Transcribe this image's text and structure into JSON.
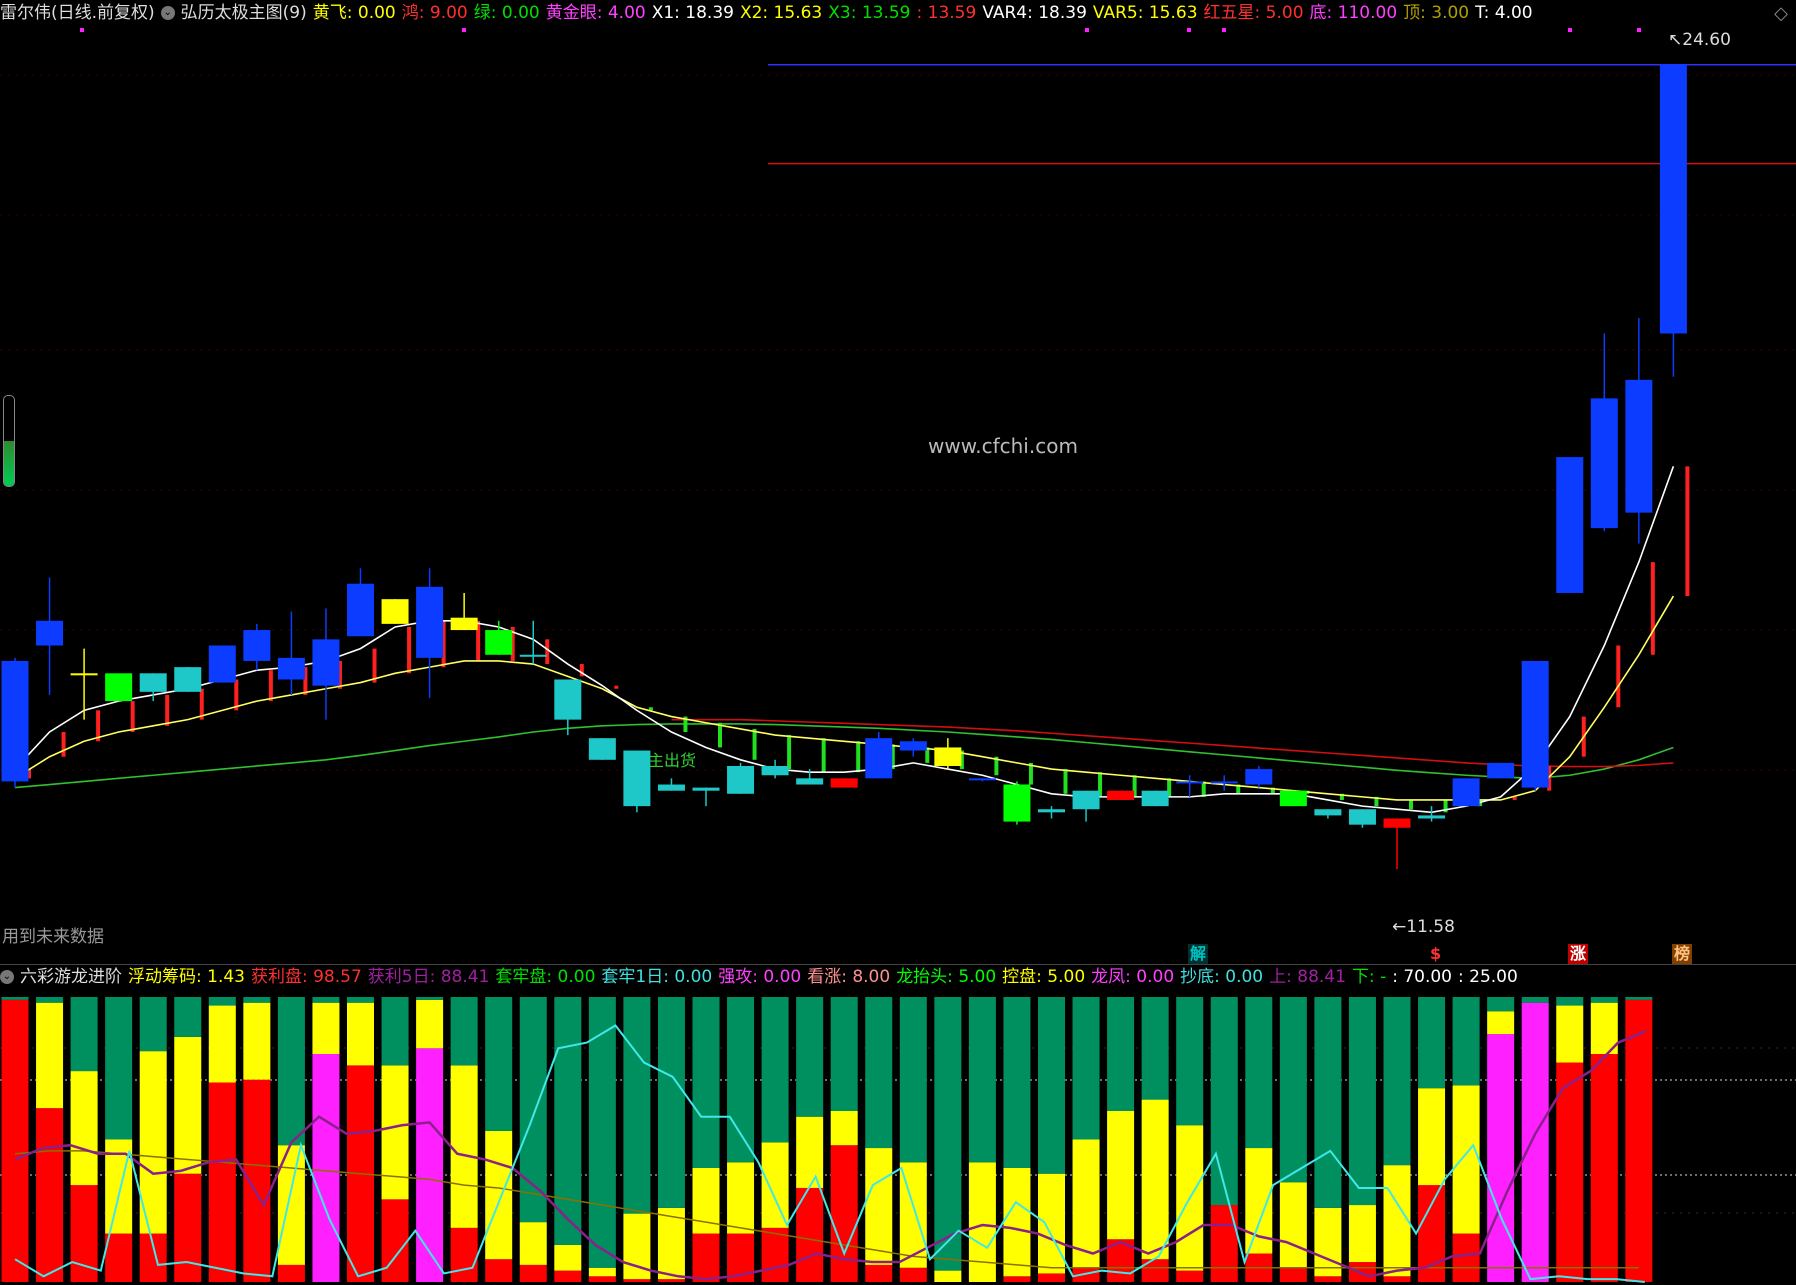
{
  "main_panel": {
    "title": "雷尔伟(日线.前复权)",
    "indicator_name": "弘历太极主图(9)",
    "indicators": [
      {
        "label": "黄飞:",
        "value": "0.00",
        "color": "#ffff00"
      },
      {
        "label": "鸿:",
        "value": "9.00",
        "color": "#ff3030"
      },
      {
        "label": "绿:",
        "value": "0.00",
        "color": "#00e000"
      },
      {
        "label": "黄金眼:",
        "value": "4.00",
        "color": "#ff40ff"
      },
      {
        "label": "X1:",
        "value": "18.39",
        "color": "#ffffff"
      },
      {
        "label": "X2:",
        "value": "15.63",
        "color": "#ffff00"
      },
      {
        "label": "X3:",
        "value": "13.59",
        "color": "#00e000"
      },
      {
        "label": ":",
        "value": "13.59",
        "color": "#ff3030"
      },
      {
        "label": "VAR4:",
        "value": "18.39",
        "color": "#ffffff"
      },
      {
        "label": "VAR5:",
        "value": "15.63",
        "color": "#ffff00"
      },
      {
        "label": "红五星:",
        "value": "5.00",
        "color": "#ff3030"
      },
      {
        "label": "底:",
        "value": "110.00",
        "color": "#ff40ff"
      },
      {
        "label": "顶:",
        "value": "3.00",
        "color": "#b0a000"
      },
      {
        "label": "T:",
        "value": "4.00",
        "color": "#ffffff"
      }
    ],
    "watermark": "www.cfchi.com",
    "future_data_note": "用到未来数据",
    "high_marker": "24.60",
    "low_marker": "11.58",
    "overlay_text": "主出货",
    "signal_badges": [
      {
        "text": "解",
        "color": "#00c0c0",
        "bg": "#003030"
      },
      {
        "text": "$",
        "color": "#ff3030",
        "bg": "transparent"
      },
      {
        "text": "涨",
        "color": "#ffffff",
        "bg": "#c00000"
      },
      {
        "text": "榜",
        "color": "#ffc080",
        "bg": "#804000"
      }
    ]
  },
  "sub_panel": {
    "indicator_name": "六彩游龙进阶",
    "indicators": [
      {
        "label": "浮动筹码:",
        "value": "1.43",
        "color": "#ffff00"
      },
      {
        "label": "获利盘:",
        "value": "98.57",
        "color": "#ff3030"
      },
      {
        "label": "获利5日:",
        "value": "88.41",
        "color": "#a020a0"
      },
      {
        "label": "套牢盘:",
        "value": "0.00",
        "color": "#00e000"
      },
      {
        "label": "套牢1日:",
        "value": "0.00",
        "color": "#40e0e0"
      },
      {
        "label": "强攻:",
        "value": "0.00",
        "color": "#ff40ff"
      },
      {
        "label": "看涨:",
        "value": "8.00",
        "color": "#ff9090"
      },
      {
        "label": "龙抬头:",
        "value": "5.00",
        "color": "#00ff00"
      },
      {
        "label": "控盘:",
        "value": "5.00",
        "color": "#ffff00"
      },
      {
        "label": "龙凤:",
        "value": "0.00",
        "color": "#ff40ff"
      },
      {
        "label": "抄底:",
        "value": "0.00",
        "color": "#40e0e0"
      },
      {
        "label": "上:",
        "value": "88.41",
        "color": "#a020a0"
      },
      {
        "label": "下:",
        "value": "-",
        "color": "#00e000"
      },
      {
        "label": ":",
        "value": "70.00",
        "color": "#ffffff"
      },
      {
        "label": ":",
        "value": "25.00",
        "color": "#ffffff"
      }
    ]
  },
  "colors": {
    "up_blue": "#0b3cff",
    "down_cyan": "#1ec8c8",
    "yellow": "#ffff00",
    "green": "#00ff00",
    "red": "#ff0000",
    "magenta": "#ff20ff",
    "dark_green": "#009060",
    "ma_white": "#ffffff",
    "ma_yellow": "#ffff60",
    "ma_green": "#30c030",
    "ma_red": "#d01010"
  },
  "chart_data": {
    "type": "candlestick",
    "price_range": [
      11.0,
      25.0
    ],
    "candles": [
      {
        "o": 13.0,
        "h": 15.0,
        "l": 12.9,
        "c": 14.95,
        "color": "blue"
      },
      {
        "o": 15.2,
        "h": 16.3,
        "l": 14.4,
        "c": 15.6,
        "color": "blue"
      },
      {
        "o": 14.75,
        "h": 15.15,
        "l": 14.0,
        "c": 14.75,
        "color": "yellow"
      },
      {
        "o": 14.3,
        "h": 14.7,
        "l": 14.3,
        "c": 14.75,
        "color": "green"
      },
      {
        "o": 14.45,
        "h": 14.75,
        "l": 14.3,
        "c": 14.75,
        "color": "cyan"
      },
      {
        "o": 14.45,
        "h": 14.85,
        "l": 14.45,
        "c": 14.85,
        "color": "cyan"
      },
      {
        "o": 14.6,
        "h": 15.2,
        "l": 14.6,
        "c": 15.2,
        "color": "blue"
      },
      {
        "o": 14.95,
        "h": 15.55,
        "l": 14.8,
        "c": 15.45,
        "color": "blue"
      },
      {
        "o": 14.65,
        "h": 15.75,
        "l": 14.4,
        "c": 15.0,
        "color": "blue"
      },
      {
        "o": 14.55,
        "h": 15.8,
        "l": 14.0,
        "c": 15.3,
        "color": "blue"
      },
      {
        "o": 15.35,
        "h": 16.45,
        "l": 15.35,
        "c": 16.2,
        "color": "blue"
      },
      {
        "o": 15.55,
        "h": 15.95,
        "l": 15.55,
        "c": 15.95,
        "color": "yellow"
      },
      {
        "o": 15.0,
        "h": 16.45,
        "l": 14.35,
        "c": 16.15,
        "color": "blue"
      },
      {
        "o": 15.65,
        "h": 16.05,
        "l": 15.45,
        "c": 15.45,
        "color": "yellow"
      },
      {
        "o": 15.45,
        "h": 15.6,
        "l": 15.05,
        "c": 15.05,
        "color": "green"
      },
      {
        "o": 15.05,
        "h": 15.6,
        "l": 14.9,
        "c": 15.05,
        "color": "cyan"
      },
      {
        "o": 14.65,
        "h": 14.65,
        "l": 13.75,
        "c": 14.0,
        "color": "cyan"
      },
      {
        "o": 13.7,
        "h": 13.7,
        "l": 13.35,
        "c": 13.35,
        "color": "cyan"
      },
      {
        "o": 13.5,
        "h": 13.5,
        "l": 12.5,
        "c": 12.6,
        "color": "cyan"
      },
      {
        "o": 12.95,
        "h": 13.05,
        "l": 12.85,
        "c": 12.85,
        "color": "cyan"
      },
      {
        "o": 12.9,
        "h": 12.9,
        "l": 12.6,
        "c": 12.85,
        "color": "cyan"
      },
      {
        "o": 13.25,
        "h": 13.3,
        "l": 12.8,
        "c": 12.8,
        "color": "cyan"
      },
      {
        "o": 13.25,
        "h": 13.35,
        "l": 13.05,
        "c": 13.1,
        "color": "cyan"
      },
      {
        "o": 13.05,
        "h": 13.2,
        "l": 12.95,
        "c": 12.95,
        "color": "cyan"
      },
      {
        "o": 13.05,
        "h": 13.05,
        "l": 12.9,
        "c": 12.9,
        "color": "red"
      },
      {
        "o": 13.05,
        "h": 13.8,
        "l": 13.05,
        "c": 13.7,
        "color": "blue"
      },
      {
        "o": 13.5,
        "h": 13.7,
        "l": 13.4,
        "c": 13.65,
        "color": "blue"
      },
      {
        "o": 13.25,
        "h": 13.7,
        "l": 13.2,
        "c": 13.55,
        "color": "yellow"
      },
      {
        "o": 13.05,
        "h": 13.05,
        "l": 13.0,
        "c": 13.05,
        "color": "blue"
      },
      {
        "o": 12.35,
        "h": 13.0,
        "l": 12.3,
        "c": 12.95,
        "color": "green"
      },
      {
        "o": 12.5,
        "h": 12.6,
        "l": 12.4,
        "c": 12.55,
        "color": "cyan"
      },
      {
        "o": 12.85,
        "h": 12.85,
        "l": 12.35,
        "c": 12.55,
        "color": "cyan"
      },
      {
        "o": 12.7,
        "h": 12.85,
        "l": 12.7,
        "c": 12.85,
        "color": "red"
      },
      {
        "o": 12.85,
        "h": 12.85,
        "l": 12.6,
        "c": 12.6,
        "color": "cyan"
      },
      {
        "o": 13.0,
        "h": 13.1,
        "l": 12.75,
        "c": 13.0,
        "color": "blue"
      },
      {
        "o": 13.0,
        "h": 13.1,
        "l": 12.85,
        "c": 13.0,
        "color": "blue"
      },
      {
        "o": 13.2,
        "h": 13.25,
        "l": 12.9,
        "c": 12.95,
        "color": "blue"
      },
      {
        "o": 12.85,
        "h": 12.85,
        "l": 12.6,
        "c": 12.6,
        "color": "green"
      },
      {
        "o": 12.55,
        "h": 12.55,
        "l": 12.4,
        "c": 12.45,
        "color": "cyan"
      },
      {
        "o": 12.55,
        "h": 12.55,
        "l": 12.25,
        "c": 12.3,
        "color": "cyan"
      },
      {
        "o": 12.4,
        "h": 12.4,
        "l": 11.58,
        "c": 12.25,
        "color": "red"
      },
      {
        "o": 12.4,
        "h": 12.6,
        "l": 12.35,
        "c": 12.45,
        "color": "cyan"
      },
      {
        "o": 12.6,
        "h": 13.05,
        "l": 12.6,
        "c": 13.05,
        "color": "blue"
      },
      {
        "o": 13.05,
        "h": 13.3,
        "l": 13.05,
        "c": 13.3,
        "color": "blue"
      },
      {
        "o": 12.9,
        "h": 14.95,
        "l": 12.85,
        "c": 14.95,
        "color": "blue"
      },
      {
        "o": 16.05,
        "h": 18.25,
        "l": 16.05,
        "c": 18.25,
        "color": "blue"
      },
      {
        "o": 17.1,
        "h": 20.25,
        "l": 17.05,
        "c": 19.2,
        "color": "blue"
      },
      {
        "o": 17.35,
        "h": 20.5,
        "l": 16.85,
        "c": 19.5,
        "color": "blue"
      },
      {
        "o": 20.25,
        "h": 24.6,
        "l": 19.55,
        "c": 24.6,
        "color": "blue"
      }
    ],
    "ma_white": [
      13.2,
      13.8,
      14.15,
      14.3,
      14.4,
      14.5,
      14.65,
      14.8,
      14.85,
      14.95,
      15.15,
      15.5,
      15.6,
      15.6,
      15.5,
      15.3,
      14.9,
      14.55,
      14.15,
      13.8,
      13.55,
      13.35,
      13.2,
      13.15,
      13.15,
      13.2,
      13.3,
      13.2,
      13.1,
      12.95,
      12.8,
      12.75,
      12.75,
      12.75,
      12.75,
      12.8,
      12.8,
      12.8,
      12.7,
      12.6,
      12.55,
      12.5,
      12.6,
      12.75,
      13.25,
      14.05,
      15.2,
      16.55,
      18.1
    ],
    "ma_yellow": [
      13.05,
      13.4,
      13.65,
      13.8,
      13.9,
      14.0,
      14.15,
      14.3,
      14.4,
      14.5,
      14.6,
      14.75,
      14.85,
      14.95,
      14.95,
      14.9,
      14.7,
      14.5,
      14.2,
      14.05,
      13.95,
      13.85,
      13.75,
      13.7,
      13.65,
      13.6,
      13.55,
      13.5,
      13.4,
      13.3,
      13.2,
      13.15,
      13.1,
      13.05,
      13.0,
      12.95,
      12.9,
      12.85,
      12.8,
      12.75,
      12.7,
      12.7,
      12.7,
      12.7,
      12.85,
      13.4,
      14.2,
      15.05,
      16.0
    ],
    "ma_green": [
      12.9,
      12.95,
      13.0,
      13.05,
      13.1,
      13.15,
      13.2,
      13.25,
      13.3,
      13.35,
      13.42,
      13.5,
      13.58,
      13.65,
      13.72,
      13.8,
      13.86,
      13.9,
      13.92,
      13.93,
      13.93,
      13.93,
      13.92,
      13.9,
      13.88,
      13.86,
      13.83,
      13.8,
      13.76,
      13.72,
      13.68,
      13.63,
      13.58,
      13.53,
      13.48,
      13.43,
      13.38,
      13.33,
      13.28,
      13.23,
      13.18,
      13.14,
      13.1,
      13.07,
      13.05,
      13.1,
      13.2,
      13.35,
      13.55
    ],
    "ma_red_from_index": 19,
    "ma_red": [
      14.0,
      14.0,
      14.0,
      13.98,
      13.96,
      13.94,
      13.92,
      13.9,
      13.88,
      13.85,
      13.82,
      13.78,
      13.74,
      13.7,
      13.66,
      13.62,
      13.58,
      13.54,
      13.5,
      13.46,
      13.42,
      13.38,
      13.34,
      13.3,
      13.27,
      13.25,
      13.24,
      13.24,
      13.26,
      13.3
    ],
    "horizontal_lines": [
      {
        "price": 24.6,
        "color": "#3030ff"
      },
      {
        "price": 23.0,
        "color": "#d01010"
      }
    ],
    "sub_bars": [
      {
        "m": 0,
        "r": 99,
        "y": 0,
        "g": 1
      },
      {
        "m": 0,
        "r": 61,
        "y": 37,
        "g": 2
      },
      {
        "m": 0,
        "r": 34,
        "y": 40,
        "g": 26
      },
      {
        "m": 0,
        "r": 17,
        "y": 33,
        "g": 50
      },
      {
        "m": 0,
        "r": 17,
        "y": 64,
        "g": 19
      },
      {
        "m": 0,
        "r": 38,
        "y": 48,
        "g": 14
      },
      {
        "m": 0,
        "r": 70,
        "y": 27,
        "g": 3
      },
      {
        "m": 0,
        "r": 71,
        "y": 27,
        "g": 2
      },
      {
        "m": 0,
        "r": 6,
        "y": 42,
        "g": 52
      },
      {
        "m": 80,
        "r": 0,
        "y": 18,
        "g": 2
      },
      {
        "m": 0,
        "r": 76,
        "y": 22,
        "g": 2
      },
      {
        "m": 0,
        "r": 29,
        "y": 47,
        "g": 24
      },
      {
        "m": 82,
        "r": 0,
        "y": 17,
        "g": 1
      },
      {
        "m": 0,
        "r": 19,
        "y": 57,
        "g": 24
      },
      {
        "m": 0,
        "r": 8,
        "y": 45,
        "g": 47
      },
      {
        "m": 0,
        "r": 6,
        "y": 15,
        "g": 79
      },
      {
        "m": 0,
        "r": 4,
        "y": 9,
        "g": 87
      },
      {
        "m": 0,
        "r": 2,
        "y": 3,
        "g": 95
      },
      {
        "m": 0,
        "r": 1,
        "y": 23,
        "g": 76
      },
      {
        "m": 0,
        "r": 1,
        "y": 25,
        "g": 74
      },
      {
        "m": 0,
        "r": 17,
        "y": 23,
        "g": 60
      },
      {
        "m": 0,
        "r": 17,
        "y": 25,
        "g": 58
      },
      {
        "m": 0,
        "r": 19,
        "y": 30,
        "g": 51
      },
      {
        "m": 0,
        "r": 33,
        "y": 25,
        "g": 42
      },
      {
        "m": 0,
        "r": 48,
        "y": 12,
        "g": 40
      },
      {
        "m": 0,
        "r": 6,
        "y": 41,
        "g": 53
      },
      {
        "m": 0,
        "r": 5,
        "y": 37,
        "g": 58
      },
      {
        "m": 0,
        "r": 0,
        "y": 4,
        "g": 96
      },
      {
        "m": 0,
        "r": 0,
        "y": 42,
        "g": 58
      },
      {
        "m": 0,
        "r": 2,
        "y": 38,
        "g": 60
      },
      {
        "m": 0,
        "r": 3,
        "y": 35,
        "g": 62
      },
      {
        "m": 0,
        "r": 5,
        "y": 45,
        "g": 50
      },
      {
        "m": 0,
        "r": 15,
        "y": 45,
        "g": 40
      },
      {
        "m": 0,
        "r": 8,
        "y": 56,
        "g": 36
      },
      {
        "m": 0,
        "r": 4,
        "y": 51,
        "g": 45
      },
      {
        "m": 0,
        "r": 27,
        "y": 0,
        "g": 73
      },
      {
        "m": 0,
        "r": 10,
        "y": 37,
        "g": 53
      },
      {
        "m": 0,
        "r": 5,
        "y": 30,
        "g": 65
      },
      {
        "m": 0,
        "r": 2,
        "y": 24,
        "g": 74
      },
      {
        "m": 0,
        "r": 7,
        "y": 20,
        "g": 73
      },
      {
        "m": 0,
        "r": 2,
        "y": 39,
        "g": 59
      },
      {
        "m": 0,
        "r": 34,
        "y": 34,
        "g": 32
      },
      {
        "m": 0,
        "r": 17,
        "y": 52,
        "g": 31
      },
      {
        "m": 87,
        "r": 0,
        "y": 8,
        "g": 5
      },
      {
        "m": 98,
        "r": 0,
        "y": 0,
        "g": 2
      },
      {
        "m": 0,
        "r": 77,
        "y": 20,
        "g": 3
      },
      {
        "m": 0,
        "r": 80,
        "y": 18,
        "g": 2
      },
      {
        "m": 0,
        "r": 99,
        "y": 0,
        "g": 1
      }
    ],
    "sub_cyan_line": [
      8,
      2,
      7,
      4,
      46,
      6,
      7,
      5,
      3,
      2,
      48,
      22,
      2,
      5,
      18,
      3,
      5,
      30,
      55,
      82,
      84,
      90,
      77,
      72,
      58,
      58,
      42,
      20,
      37,
      10,
      34,
      40,
      8,
      18,
      12,
      28,
      21,
      2,
      4,
      3,
      9,
      28,
      45,
      7,
      34,
      40,
      46,
      33,
      33,
      17,
      36,
      48,
      22,
      1,
      2,
      1,
      1,
      0
    ],
    "sub_cyan_x_indices": [
      0,
      0.5,
      1,
      1.5,
      2.5,
      3,
      3.5,
      4,
      4.5,
      5,
      5.5,
      6,
      6.5,
      7,
      7.5,
      8,
      8.5,
      9,
      9.5,
      10,
      10.5,
      11,
      11.5,
      12,
      12.5,
      13,
      13.5,
      14,
      14.5,
      15,
      15.5,
      16,
      16.5,
      17,
      17.5,
      18,
      18.5,
      19,
      19.5,
      20,
      20.5,
      21,
      21.5,
      22,
      22.5,
      23,
      23.5,
      24,
      24.5,
      25,
      25.5,
      26,
      26.5,
      27,
      27.5,
      28,
      28.5,
      29
    ],
    "sub_purple_line": [
      43,
      47,
      48,
      45,
      45,
      38,
      39,
      42,
      43,
      27,
      49,
      58,
      52,
      53,
      55,
      56,
      45,
      43,
      40,
      32,
      22,
      13,
      7,
      4,
      2,
      1,
      2,
      4,
      6,
      10,
      8,
      7,
      7,
      12,
      17,
      20,
      19,
      17,
      13,
      10,
      14,
      10,
      14,
      20,
      20,
      16,
      14,
      10,
      6,
      2,
      4,
      5,
      9,
      10,
      32,
      52,
      68,
      74,
      84,
      88
    ],
    "sub_dark_line": [
      45,
      46,
      46,
      45,
      44,
      43,
      42,
      41,
      40,
      39,
      38,
      37,
      36,
      34,
      33,
      31,
      29,
      27,
      25,
      23,
      21,
      19,
      17,
      15,
      13,
      11,
      9,
      8,
      7,
      6,
      5,
      5,
      5,
      5,
      5,
      5,
      5,
      5,
      5,
      5,
      5,
      5,
      5,
      5,
      5,
      5,
      5,
      5
    ]
  }
}
